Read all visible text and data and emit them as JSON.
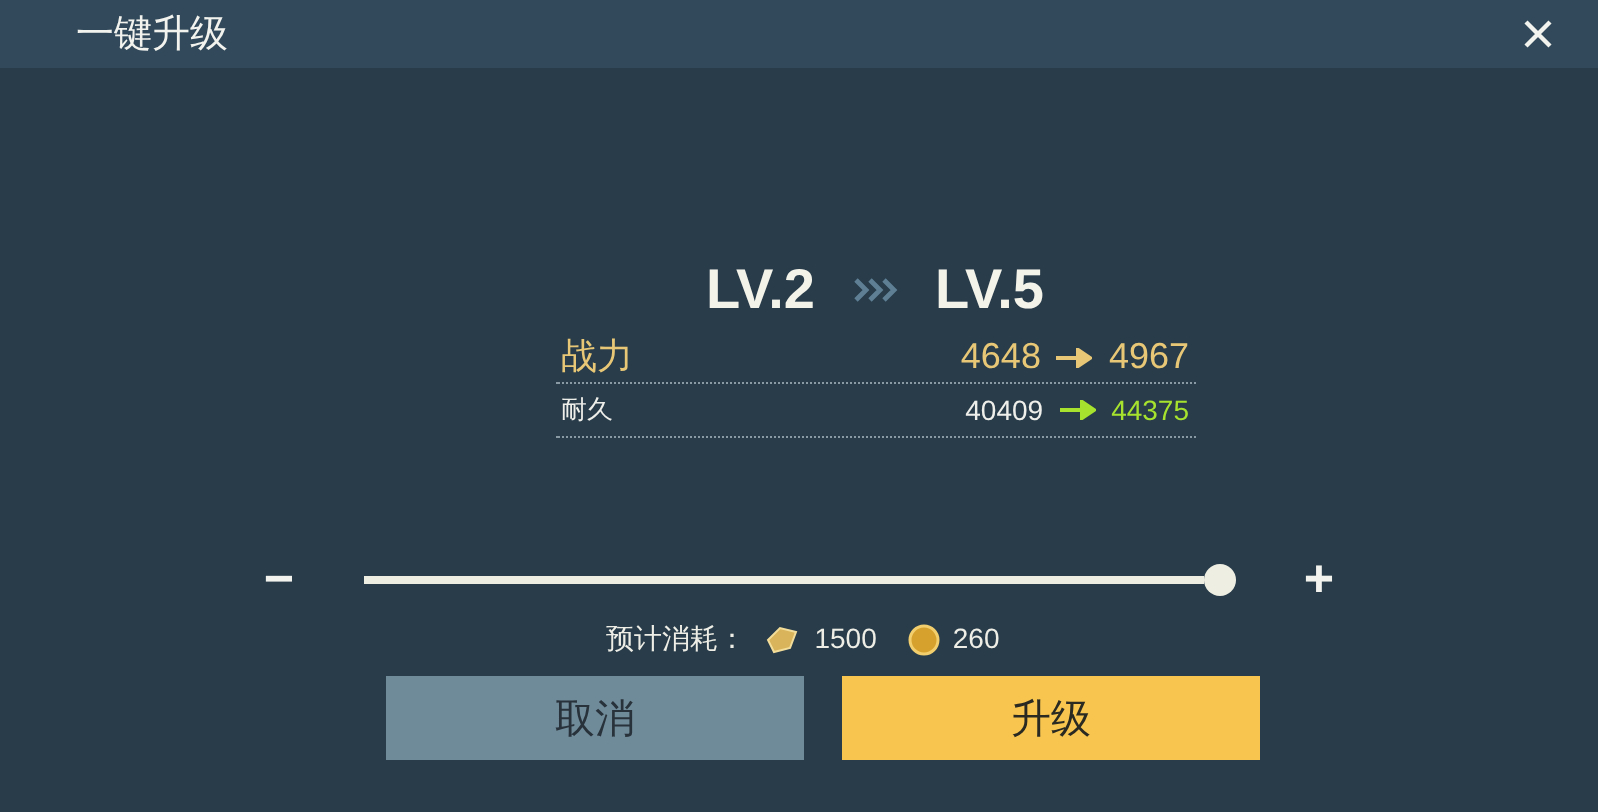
{
  "window": {
    "title": "一键升级"
  },
  "levels": {
    "from": "LV.2",
    "to": "LV.5"
  },
  "stats": [
    {
      "kind": "primary",
      "label": "战力",
      "from": "4648",
      "to": "4967"
    },
    {
      "kind": "secondary",
      "label": "耐久",
      "from": "40409",
      "to": "44375"
    }
  ],
  "slider": {
    "minus": "−",
    "plus": "+",
    "level": 1.0
  },
  "cost": {
    "label": "预计消耗：",
    "items": [
      {
        "kind": "xp",
        "amount": "1500"
      },
      {
        "kind": "coin",
        "amount": "260"
      }
    ]
  },
  "buttons": [
    {
      "kind": "cancel",
      "label": "取消"
    },
    {
      "kind": "confirm",
      "label": "升级"
    }
  ]
}
